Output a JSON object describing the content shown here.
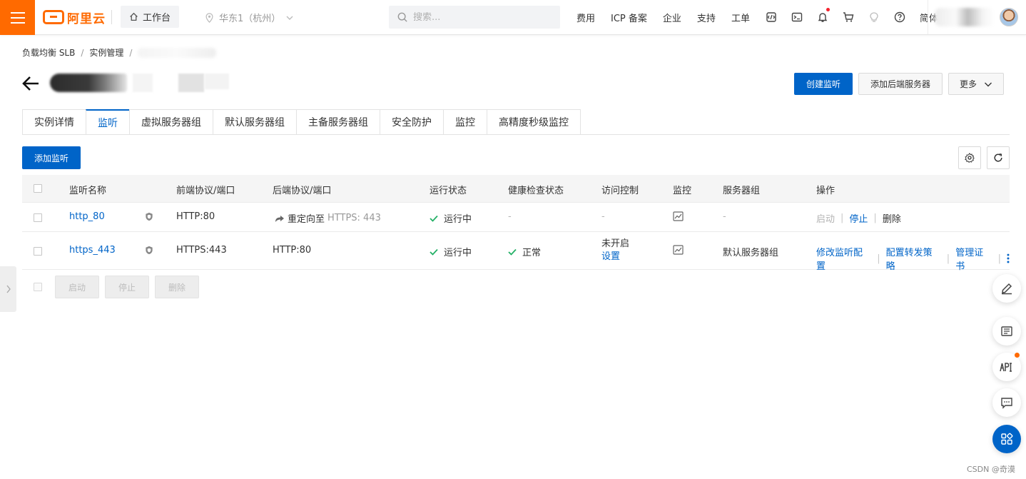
{
  "topbar": {
    "logo_text": "阿里云",
    "workbench": "工作台",
    "region": "华东1（杭州）",
    "search_placeholder": "搜索...",
    "nav": [
      "费用",
      "ICP 备案",
      "企业",
      "支持",
      "工单"
    ],
    "lang": "简体"
  },
  "breadcrumb": {
    "items": [
      "负载均衡 SLB",
      "实例管理"
    ]
  },
  "actions": {
    "create_listener": "创建监听",
    "add_backend": "添加后端服务器",
    "more": "更多"
  },
  "tabs": [
    "实例详情",
    "监听",
    "虚拟服务器组",
    "默认服务器组",
    "主备服务器组",
    "安全防护",
    "监控",
    "高精度秒级监控"
  ],
  "active_tab": "监听",
  "toolbar": {
    "add_listener": "添加监听"
  },
  "table": {
    "headers": [
      "监听名称",
      "前端协议/端口",
      "后端协议/端口",
      "运行状态",
      "健康检查状态",
      "访问控制",
      "监控",
      "服务器组",
      "操作"
    ],
    "rows": [
      {
        "name": "http_80",
        "frontend": "HTTP:80",
        "backend_prefix": "重定向至",
        "backend": "HTTPS: 443",
        "status": "运行中",
        "health": "-",
        "acl": "-",
        "server_group": "-",
        "ops": [
          "启动",
          "停止",
          "删除"
        ]
      },
      {
        "name": "https_443",
        "frontend": "HTTPS:443",
        "backend": "HTTP:80",
        "status": "运行中",
        "health": "正常",
        "acl": "未开启",
        "acl_link": "设置",
        "server_group": "默认服务器组",
        "ops": [
          "修改监听配置",
          "配置转发策略",
          "管理证书"
        ]
      }
    ]
  },
  "bulk": {
    "start": "启动",
    "stop": "停止",
    "delete": "删除"
  },
  "watermark": "CSDN @奇漠",
  "colors": {
    "brand": "#ff6a00",
    "primary": "#0064c8",
    "success": "#23b066"
  }
}
